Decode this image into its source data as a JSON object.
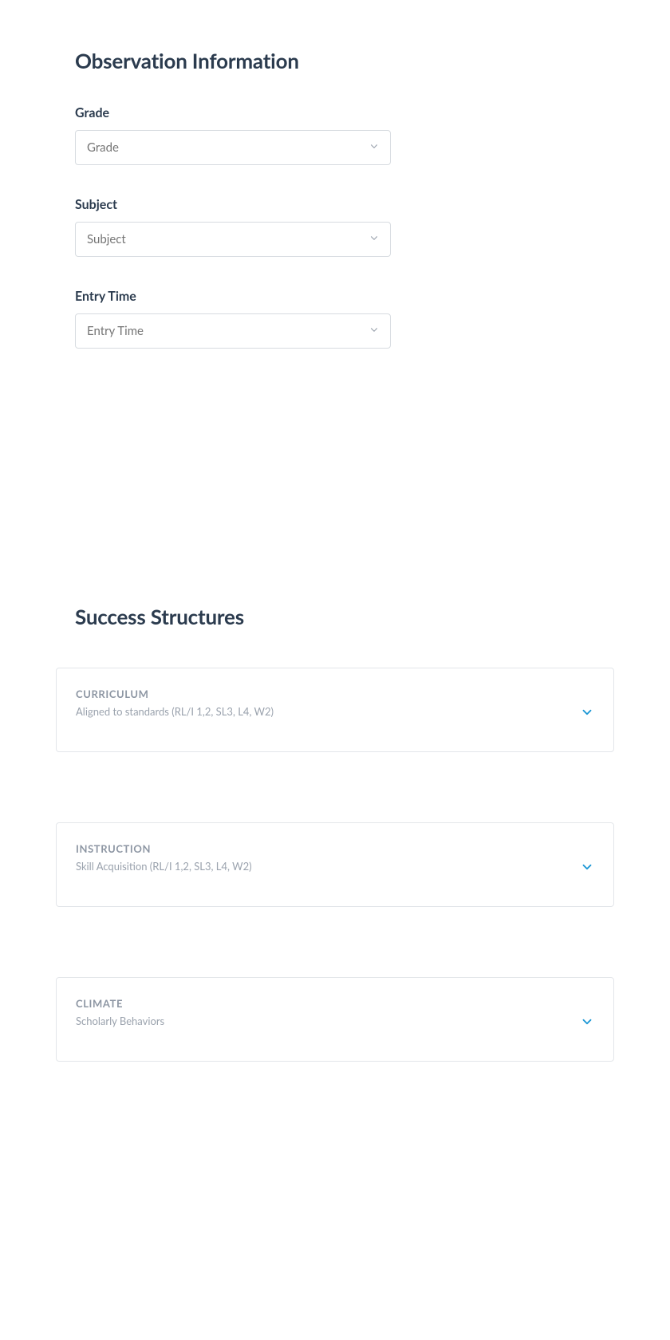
{
  "observation": {
    "title": "Observation Information",
    "fields": [
      {
        "label": "Grade",
        "placeholder": "Grade"
      },
      {
        "label": "Subject",
        "placeholder": "Subject"
      },
      {
        "label": "Entry Time",
        "placeholder": "Entry Time"
      }
    ]
  },
  "structures": {
    "title": "Success Structures",
    "cards": [
      {
        "category": "CURRICULUM",
        "subtitle": "Aligned to standards (RL/I 1,2, SL3, L4, W2)"
      },
      {
        "category": "INSTRUCTION",
        "subtitle": "Skill Acquisition (RL/I 1,2, SL3, L4, W2)"
      },
      {
        "category": "CLIMATE",
        "subtitle": "Scholarly Behaviors"
      }
    ]
  }
}
